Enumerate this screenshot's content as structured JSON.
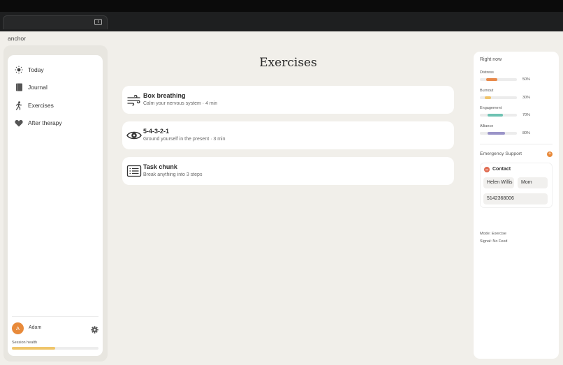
{
  "app": {
    "name": "anchor"
  },
  "sidebar": {
    "items": [
      {
        "label": "Today",
        "icon": "sun-icon"
      },
      {
        "label": "Journal",
        "icon": "book-icon"
      },
      {
        "label": "Exercises",
        "icon": "walking-person-icon"
      },
      {
        "label": "After therapy",
        "icon": "heart-icon"
      }
    ],
    "user": {
      "initial": "A",
      "name": "Adam"
    },
    "session": {
      "label": "Session health",
      "level": 0.5
    }
  },
  "main": {
    "title": "Exercises",
    "cards": [
      {
        "title": "Box breathing",
        "subtitle": "Calm your nervous system · 4 min",
        "icon": "wind-icon"
      },
      {
        "title": "5-4-3-2-1",
        "subtitle": "Ground yourself in the present · 3 min",
        "icon": "eye-icon"
      },
      {
        "title": "Task chunk",
        "subtitle": "Break anything into 3 steps",
        "icon": "checklist-icon"
      }
    ]
  },
  "right_panel": {
    "title": "Right now",
    "metrics": [
      {
        "label": "Distress",
        "value": "50%",
        "level": 0.5,
        "color": "#e8894a"
      },
      {
        "label": "Burnout",
        "value": "30%",
        "level": 0.3,
        "color": "#f0c36a"
      },
      {
        "label": "Engagement",
        "value": "70%",
        "level": 0.7,
        "color": "#6ec2b2"
      },
      {
        "label": "Alliance",
        "value": "80%",
        "level": 0.8,
        "color": "#9a94c8"
      }
    ],
    "emergency": {
      "title": "Emergency Support",
      "contact_title": "Contact",
      "name_value": "Helen Willis",
      "relation_value": "Mom",
      "phone_value": "5142368006"
    },
    "mode": "Mode: Exercise",
    "signal": "Signal: No Feed"
  },
  "colors": {
    "accent": "#e88a3a",
    "background": "#f1efea",
    "card": "#ffffff"
  }
}
